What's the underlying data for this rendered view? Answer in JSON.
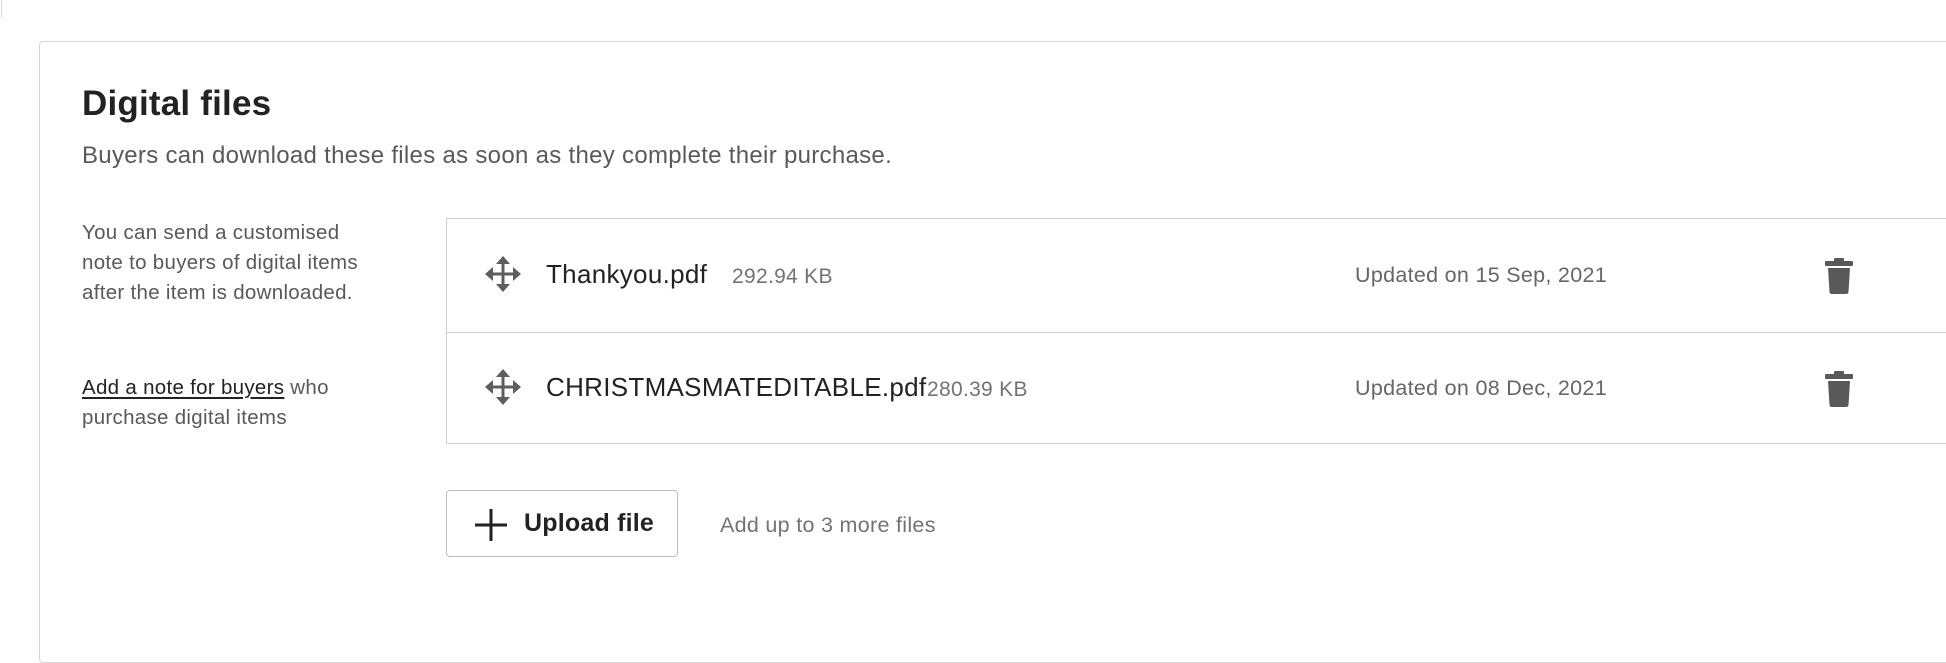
{
  "section": {
    "title": "Digital files",
    "subtitle": "Buyers can download these files as soon as they complete their purchase."
  },
  "side_note": {
    "text": "You can send a customised note to buyers of digital items after the item is downloaded.",
    "link_label": "Add a note for buyers",
    "link_suffix": " who purchase digital items"
  },
  "files": [
    {
      "name": "Thankyou.pdf",
      "size": "292.94 KB",
      "updated": "Updated on 15 Sep, 2021",
      "move_icon": "move-icon",
      "delete_icon": "trash-icon"
    },
    {
      "name": "CHRISTMASMATEDITABLE.pdf",
      "size": "280.39 KB",
      "updated": "Updated on 08 Dec, 2021",
      "move_icon": "move-icon",
      "delete_icon": "trash-icon"
    }
  ],
  "upload": {
    "button_label": "Upload file",
    "icon": "plus-icon",
    "hint": "Add up to 3 more files"
  },
  "colors": {
    "text_primary": "#222222",
    "text_secondary": "#595959",
    "text_muted": "#737373",
    "border": "#d6d6d6",
    "icon": "#595959"
  }
}
